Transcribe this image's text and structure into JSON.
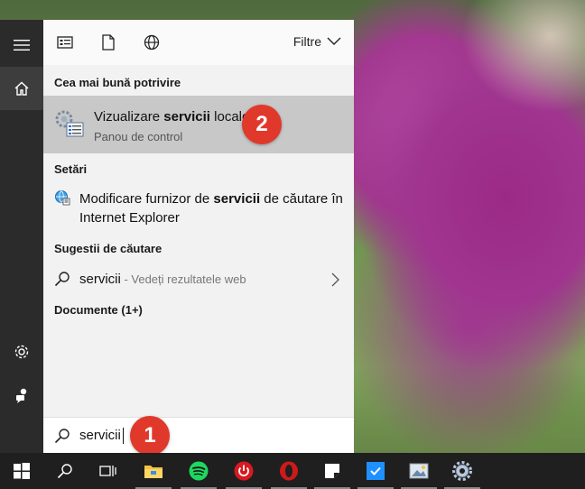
{
  "start_menu": {
    "header": {
      "filter_label": "Filtre",
      "icons": [
        "apps-icon",
        "document-icon",
        "globe-icon"
      ]
    },
    "best_match": {
      "section_title": "Cea mai bună potrivire",
      "title_prefix": "Vizualizare ",
      "title_bold": "servicii",
      "title_suffix": " locale",
      "subtitle": "Panou de control",
      "badge": "2"
    },
    "settings": {
      "section_title": "Setări",
      "item_prefix": "Modificare furnizor de ",
      "item_bold": "servicii",
      "item_suffix": " de căutare în Internet Explorer"
    },
    "suggestions": {
      "section_title": "Sugestii de căutare",
      "item_text": "servicii",
      "item_sub": " - Vedeți rezultatele web"
    },
    "documents": {
      "section_title": "Documente (1+)"
    },
    "search": {
      "value": "servicii",
      "badge": "1"
    },
    "rail": [
      "hamburger-menu-icon",
      "home-icon",
      "settings-gear-icon",
      "user-feedback-icon"
    ]
  },
  "taskbar": {
    "items": [
      "windows-start-icon",
      "search-icon",
      "task-view-icon",
      "file-explorer-icon",
      "spotify-icon",
      "power-app-icon",
      "opera-icon",
      "sticky-notes-icon",
      "todo-app-icon",
      "photo-app-icon",
      "settings-gear-icon"
    ],
    "colors": {
      "spotify": "#1ed760",
      "power_app": "#d71920",
      "opera": "#cc1a1a",
      "todo": "#1e90ff",
      "explorer": "#f5c242"
    }
  }
}
